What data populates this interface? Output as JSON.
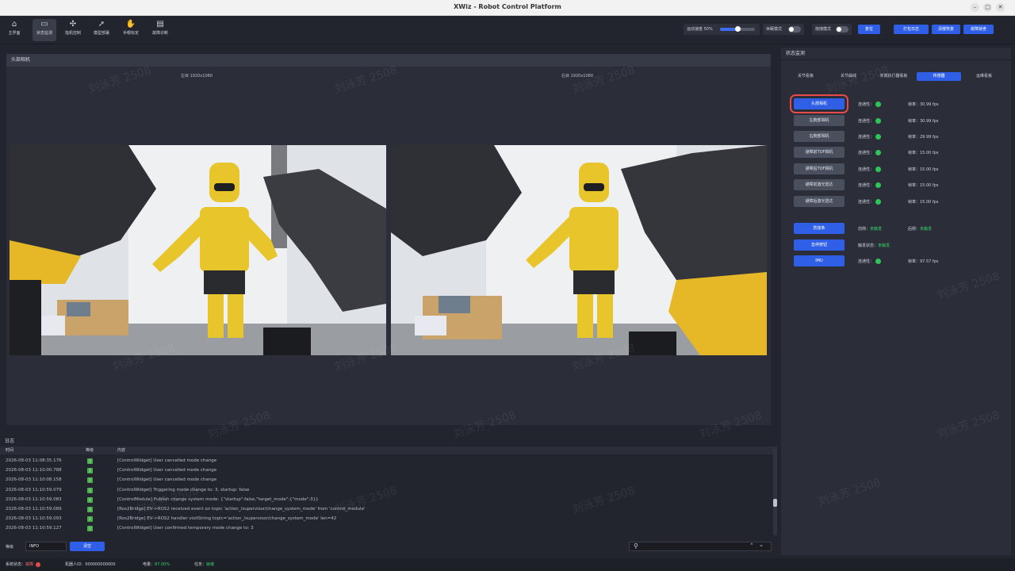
{
  "window": {
    "title": "XWiz - Robot Control Platform"
  },
  "toolbar": {
    "nav": [
      {
        "label": "主界面",
        "icon": "home-icon"
      },
      {
        "label": "状态监测",
        "icon": "monitor-icon"
      },
      {
        "label": "指机控制",
        "icon": "control-icon"
      },
      {
        "label": "模型部署",
        "icon": "rocket-icon"
      },
      {
        "label": "手眼标定",
        "icon": "hand-icon"
      },
      {
        "label": "故障诊断",
        "icon": "diagnose-icon"
      }
    ],
    "speed_label": "运动速度 50%",
    "speed_value": 0.5,
    "mode1_label": "休眠模式",
    "mode2_label": "拖拽模式",
    "reset_label": "复位",
    "log_btn": "打包日志",
    "clear_btn": "清楼恢复",
    "fault_btn": "故障锁舍"
  },
  "main": {
    "title": "头部相机",
    "left_label": "左目  1920x1080",
    "right_label": "右目  1920x1080"
  },
  "right": {
    "title": "状态监测",
    "tabs": [
      "关节看板",
      "关节曲线",
      "末端执行器看板",
      "传感器",
      "运维看板"
    ],
    "active_tab": 3,
    "cameras": [
      {
        "label": "头部相机",
        "conn": "连通性：",
        "fps": "帧率：30.99 fps"
      },
      {
        "label": "左腕部相机",
        "conn": "连通性：",
        "fps": "帧率：30.99 fps"
      },
      {
        "label": "右腕部相机",
        "conn": "连通性：",
        "fps": "帧率：29.99 fps"
      },
      {
        "label": "避障前TOF相机",
        "conn": "连通性：",
        "fps": "帧率：15.00 fps"
      },
      {
        "label": "避障后TOF相机",
        "conn": "连通性：",
        "fps": "帧率：15.00 fps"
      },
      {
        "label": "避障前激光雷达",
        "conn": "连通性：",
        "fps": "帧率：15.00 fps"
      },
      {
        "label": "避障后激光雷达",
        "conn": "连通性：",
        "fps": "帧率：15.00 fps"
      }
    ],
    "bumper": {
      "label": "防撞条",
      "front_label": "前侧：",
      "front_val": "未触发",
      "rear_label": "后侧：",
      "rear_val": "未触发"
    },
    "estop": {
      "label": "急停按钮",
      "state_label": "触发状态：",
      "state_val": "未触发"
    },
    "imu": {
      "label": "IMU",
      "conn": "连通性：",
      "fps": "帧率：97.57 fps"
    }
  },
  "log": {
    "title": "日志",
    "col_time": "时间",
    "col_level": "等级",
    "col_content": "内容",
    "rows": [
      {
        "time": "2026-08-03 11:08:35.176",
        "level": "I",
        "msg": "[ControlWidget] User cancelled mode change"
      },
      {
        "time": "2026-08-03 11:10:00.788",
        "level": "I",
        "msg": "[ControlWidget] User cancelled mode change"
      },
      {
        "time": "2026-08-03 11:10:08.158",
        "level": "I",
        "msg": "[ControlWidget] User cancelled mode change"
      },
      {
        "time": "2026-08-03 11:10:59.079",
        "level": "I",
        "msg": "[ControlWidget] Triggering mode change to: 3, startup: false"
      },
      {
        "time": "2026-08-03 11:10:59.083",
        "level": "I",
        "msg": "[ControlModule] Publish change system mode: {\"startup\":false,\"target_mode\":{\"mode\":3}}"
      },
      {
        "time": "2026-08-03 11:10:59.089",
        "level": "I",
        "msg": "[Ros2Bridge] EV->ROS2 received event on topic 'action_/supervisor/change_system_mode' from 'control_module'"
      },
      {
        "time": "2026-08-03 11:10:59.093",
        "level": "I",
        "msg": "[Ros2Bridge] EV->ROS2 handler visitString topic='action_/supervisor/change_system_mode' len=42"
      },
      {
        "time": "2026-08-03 11:10:59.127",
        "level": "I",
        "msg": "[ControlWidget] User confirmed temporary mode change to: 3"
      }
    ],
    "level_label": "等级",
    "level_value": "INFO",
    "clear_label": "清空"
  },
  "statusbar": {
    "sys_label": "系统状态：",
    "sys_val": "故障",
    "robot_label": "机器人ID：",
    "robot_val": "000000000000",
    "battery_label": "电量：",
    "battery_val": "87.00%",
    "task_label": "任务：",
    "task_val": "就绪"
  },
  "watermark": "刘泳芳 2508"
}
